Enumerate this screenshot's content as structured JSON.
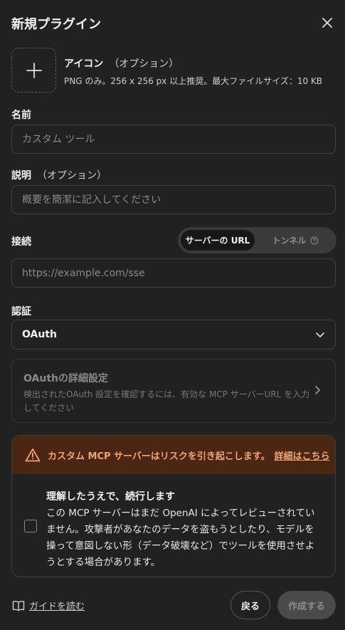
{
  "dialog": {
    "title": "新規プラグイン"
  },
  "icon": {
    "label": "アイコン",
    "optional": "（オプション）",
    "hint": "PNG のみ。256 x 256 px 以上推奨。最大ファイルサイズ：10 KB"
  },
  "name": {
    "label": "名前",
    "placeholder": "カスタム ツール"
  },
  "description": {
    "label": "説明",
    "optional": "（オプション）",
    "placeholder": "概要を簡潔に記入してください"
  },
  "connection": {
    "label": "接続",
    "options": [
      "サーバーの URL",
      "トンネル"
    ],
    "selected": "サーバーの URL",
    "url_placeholder": "https://example.com/sse"
  },
  "auth": {
    "label": "認証",
    "value": "OAuth"
  },
  "oauth_settings": {
    "title": "OAuthの詳細設定",
    "description": "検出されたOAuth 設定を確認するには、有効な MCP サーバーURL を入力してください"
  },
  "warning": {
    "message": "カスタム MCP サーバーはリスクを引き起こします。",
    "link": "詳細はこちら",
    "ack_title": "理解したうえで、続行します",
    "ack_body": "この MCP サーバーはまだ OpenAI によってレビューされていません。攻撃者があなたのデータを盗もうとしたり、モデルを操って意図しない形（データ破壊など）でツールを使用させようとする場合があります。",
    "checked": false,
    "accent_color": "#f0a47c"
  },
  "footer": {
    "guide": "ガイドを読む",
    "back": "戻る",
    "create": "作成する"
  }
}
